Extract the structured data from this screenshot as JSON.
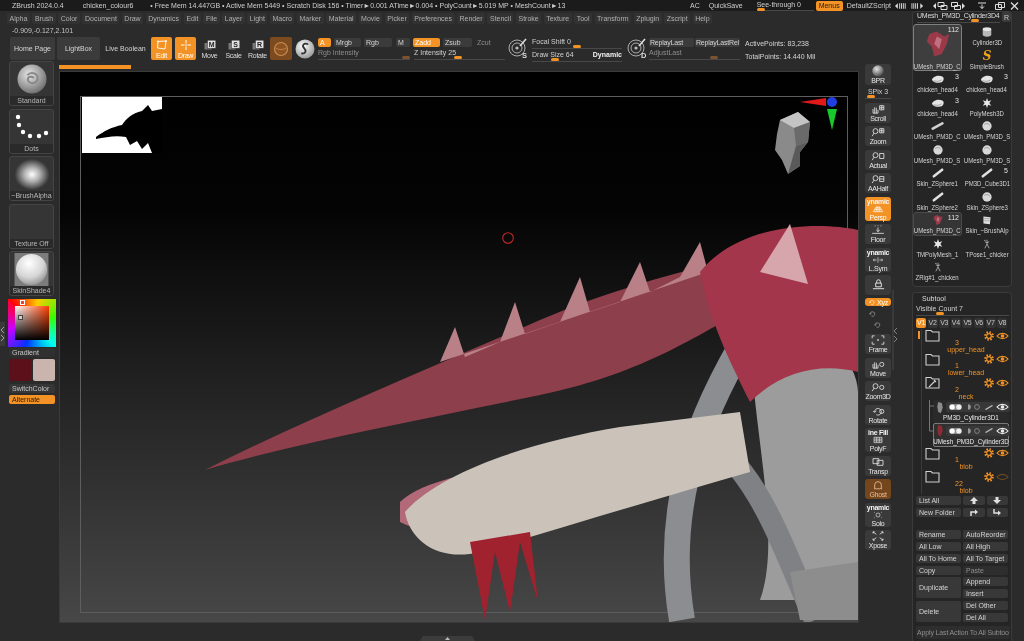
{
  "title_bar": {
    "app": "ZBrush 2024.0.4",
    "document": "chicken_colour6",
    "stats": "• Free Mem 14.447GB • Active Mem 5449 • Scratch Disk 156 • Timer►0.001 ATime►0.004 • PolyCount►5.019 MP • MeshCount►13",
    "ac": "AC",
    "quick_save": "QuickSave",
    "see_through": {
      "label": "See-through",
      "value": "0",
      "level": 0,
      "disabled": false
    },
    "menus": {
      "label": "Menus",
      "on": true
    },
    "script": "DefaultZScript"
  },
  "menu_bar": [
    "Alpha",
    "Brush",
    "Color",
    "Document",
    "Draw",
    "Dynamics",
    "Edit",
    "File",
    "Layer",
    "Light",
    "Macro",
    "Marker",
    "Material",
    "Movie",
    "Picker",
    "Preferences",
    "Render",
    "Stencil",
    "Stroke",
    "Texture",
    "Tool",
    "Transform",
    "Zplugin",
    "Zscript",
    "Help"
  ],
  "coordinates": "-0.909,-0.127,2.101",
  "top_shelf": {
    "nav_buttons": [
      {
        "label": "Home Page",
        "kind": "button",
        "on": false
      },
      {
        "label": "LightBox",
        "kind": "button",
        "on": false
      },
      {
        "label": "Live Boolean",
        "kind": "toggle",
        "on": false
      }
    ],
    "modes": [
      {
        "label": "Edit",
        "kind": "edit",
        "selected": true
      },
      {
        "label": "Draw",
        "kind": "draw",
        "selected": true
      },
      {
        "label": "Move",
        "kind": "transform",
        "key": "M",
        "selected": false
      },
      {
        "label": "Scale",
        "kind": "transform",
        "key": "S",
        "selected": false
      },
      {
        "label": "Rotate",
        "kind": "transform",
        "key": "R",
        "selected": false
      }
    ],
    "channels": [
      {
        "label": "A",
        "selected": true
      },
      {
        "label": "Mrgb",
        "selected": false
      },
      {
        "label": "Rgb",
        "selected": false
      },
      {
        "label": "M",
        "selected": false
      }
    ],
    "z_modes": [
      {
        "label": "Zadd",
        "selected": true,
        "disabled": false
      },
      {
        "label": "Zsub",
        "selected": false,
        "disabled": false
      },
      {
        "label": "Zcut",
        "selected": false,
        "disabled": true
      }
    ],
    "rgb_intensity": {
      "label": "Rgb Intensity",
      "level": 1,
      "disabled": true
    },
    "z_intensity": {
      "label": "Z Intensity",
      "value": "25",
      "level": 0.48,
      "disabled": false
    },
    "focal_key": "S",
    "focal_shift": {
      "label": "Focal Shift",
      "value": "0",
      "level": 0.5,
      "disabled": false
    },
    "draw_size": {
      "label": "Draw Size",
      "value": "64",
      "level": 0.23,
      "disabled": false,
      "dynamic": "Dynamic"
    },
    "replay_key": "D",
    "replay_buttons": [
      "ReplayLast",
      "ReplayLastRel"
    ],
    "adjust_last": {
      "label": "AdjustLast",
      "level": 0.73,
      "disabled": true
    },
    "points": [
      "ActivePoints: 83,238",
      "TotalPoints: 14.440 Mil"
    ]
  },
  "history_bar": {
    "level": 0.09
  },
  "left_panel": {
    "slots": [
      {
        "label": "Standard",
        "kind": "brush"
      },
      {
        "label": "Dots",
        "kind": "stroke"
      },
      {
        "label": "~BrushAlpha",
        "kind": "alpha"
      },
      {
        "label": "Texture Off",
        "kind": "texture"
      },
      {
        "label": "SkinShade4",
        "kind": "material"
      }
    ],
    "gradient": "Gradient",
    "swatches": [
      {
        "color": "#5c111a"
      },
      {
        "color": "#c9b4ae"
      }
    ],
    "switch_color": "SwitchColor",
    "alternate": {
      "label": "Alternate",
      "on": true
    }
  },
  "right_shelf": {
    "bpr": "BPR",
    "spix": {
      "label": "SPix",
      "value": "3",
      "level": 0.1,
      "disabled": false
    },
    "buttons": [
      {
        "label": "Scroll",
        "kind": "scroll",
        "on": false,
        "disabled": false
      },
      {
        "label": "Zoom",
        "kind": "zoom",
        "on": false,
        "disabled": false
      },
      {
        "label": "Actual",
        "kind": "actual",
        "on": false,
        "disabled": false
      },
      {
        "label": "AAHalf",
        "kind": "aahalf",
        "on": false,
        "disabled": false
      },
      {
        "top": "ynamic",
        "label": "Persp",
        "kind": "persp",
        "on": true,
        "disabled": false
      },
      {
        "label": "Floor",
        "kind": "floor",
        "on": false,
        "disabled": false
      },
      {
        "top": "ynamic",
        "label": "L.Sym",
        "kind": "lsym",
        "on": false,
        "disabled": false
      },
      {
        "kind": "lock",
        "on": false,
        "disabled": false
      },
      {
        "label": "Xyz",
        "kind": "xyz",
        "on": true,
        "disabled": false
      },
      {
        "kind": "rot_y",
        "on": false,
        "disabled": false
      },
      {
        "kind": "rot_z",
        "on": false,
        "disabled": false
      },
      {
        "label": "Frame",
        "kind": "frame",
        "on": false,
        "disabled": false
      },
      {
        "label": "Move",
        "kind": "move",
        "on": false,
        "disabled": false
      },
      {
        "label": "Zoom3D",
        "kind": "zoom3d",
        "on": false,
        "disabled": false
      },
      {
        "label": "Rotate",
        "kind": "rotate",
        "on": false,
        "disabled": false
      },
      {
        "top": "ine Fill",
        "label": "PolyF",
        "kind": "polyf",
        "on": false,
        "disabled": false
      },
      {
        "label": "Transp",
        "kind": "transp",
        "on": false,
        "disabled": false
      },
      {
        "label": "Ghost",
        "kind": "ghost",
        "on": true,
        "disabled": true
      },
      {
        "top": "ynamic",
        "label": "Solo",
        "kind": "solo",
        "on": false,
        "disabled": false
      },
      {
        "label": "Xpose",
        "kind": "xpose",
        "on": false,
        "disabled": false
      }
    ]
  },
  "tool_palette": {
    "current": "UMesh_PM3D_Cylinder3D4",
    "level": 0.72,
    "r_button": "R",
    "top_tools": [
      {
        "label": "UMesh_PM3D_C",
        "count": "112",
        "kind": "render",
        "selected": true
      },
      {
        "label": "Cylinder3D",
        "kind": "cylinder",
        "selected": false
      },
      {
        "label": "SimpleBrush",
        "kind": "simple",
        "glyph": "S",
        "selected": false
      }
    ],
    "tool_rows": [
      [
        {
          "label": "chicken_head4",
          "count": "3",
          "kind": "head",
          "selected": false
        },
        {
          "label": "chicken_head4",
          "count": "3",
          "kind": "head",
          "selected": false
        }
      ],
      [
        {
          "label": "chicken_head4",
          "count": "3",
          "kind": "head",
          "selected": false
        },
        {
          "label": "PolyMesh3D",
          "kind": "star",
          "selected": false
        }
      ],
      [
        {
          "label": "UMesh_PM3D_C",
          "kind": "tube",
          "selected": false
        },
        {
          "label": "UMesh_PM3D_S",
          "kind": "sphere",
          "selected": false
        }
      ],
      [
        {
          "label": "UMesh_PM3D_S",
          "kind": "sphere",
          "selected": false
        },
        {
          "label": "UMesh_PM3D_S",
          "kind": "sphere",
          "selected": false
        }
      ],
      [
        {
          "label": "Skin_ZSphere1",
          "kind": "stick",
          "selected": false
        },
        {
          "label": "PM3D_Cube3D1",
          "count": "5",
          "kind": "stick",
          "selected": false
        }
      ],
      [
        {
          "label": "Skin_ZSphere2",
          "kind": "stick",
          "selected": false
        },
        {
          "label": "Skin_ZSphere3",
          "kind": "sphere",
          "selected": false
        }
      ],
      [
        {
          "label": "UMesh_PM3D_C",
          "count": "112",
          "kind": "render",
          "selected": false
        },
        {
          "label": "Skin_~BrushAlp",
          "kind": "alpha",
          "selected": false
        }
      ],
      [
        {
          "label": "TMPolyMesh_1",
          "kind": "star",
          "selected": false
        },
        {
          "label": "TPose1_chicker",
          "kind": "rig",
          "selected": false
        }
      ],
      [
        {
          "label": "ZRig#1_chicken",
          "kind": "rig",
          "selected": false
        }
      ]
    ]
  },
  "subtool": {
    "title": "Subtool",
    "visible_count": {
      "label": "Visible Count",
      "value": "7",
      "level": 0.24,
      "disabled": false
    },
    "versions": [
      {
        "label": "V1",
        "selected": true
      },
      {
        "label": "V2",
        "selected": false
      },
      {
        "label": "V3",
        "selected": false
      },
      {
        "label": "V4",
        "selected": false
      },
      {
        "label": "V5",
        "selected": false
      },
      {
        "label": "V6",
        "selected": false
      },
      {
        "label": "V7",
        "selected": false
      },
      {
        "label": "V8",
        "selected": false
      }
    ],
    "items": [
      {
        "kind": "folder",
        "name": "upper_head",
        "count": "3",
        "expanded": false,
        "visible": true
      },
      {
        "kind": "folder",
        "name": "lower_head",
        "count": "1",
        "expanded": false,
        "visible": true
      },
      {
        "kind": "folder",
        "name": "neck",
        "count": "2",
        "expanded": true,
        "visible": true,
        "children": [
          {
            "kind": "mesh",
            "name": "PM3D_Cylinder3D1",
            "color": "#8c8c8c",
            "visible": true,
            "selected": false
          },
          {
            "kind": "mesh",
            "name": "UMesh_PM3D_Cylinder3D",
            "color": "#8e2a34",
            "visible": true,
            "selected": true
          }
        ]
      },
      {
        "kind": "folder",
        "name": "blob",
        "count": "1",
        "expanded": false,
        "visible": true
      },
      {
        "kind": "folder",
        "name": "blob",
        "count": "22",
        "expanded": false,
        "visible": false
      }
    ],
    "list_all": "List All",
    "new_folder": "New Folder",
    "actions": [
      {
        "label": "Rename",
        "disabled": false
      },
      {
        "label": "AutoReorder",
        "disabled": false
      },
      {
        "label": "All Low",
        "disabled": false
      },
      {
        "label": "All High",
        "disabled": false
      },
      {
        "label": "All To Home",
        "disabled": false
      },
      {
        "label": "All To Target",
        "disabled": false
      },
      {
        "label": "Copy",
        "disabled": false
      },
      {
        "label": "Paste",
        "disabled": true
      }
    ],
    "duplicate": {
      "label": "Duplicate",
      "disabled": false
    },
    "add_actions": [
      {
        "label": "Append",
        "disabled": false
      },
      {
        "label": "Insert",
        "disabled": false
      }
    ],
    "delete": {
      "label": "Delete",
      "disabled": false
    },
    "delete_actions": [
      {
        "label": "Del Other",
        "disabled": false
      },
      {
        "label": "Del All",
        "disabled": false
      }
    ],
    "apply_all": {
      "label": "Apply Last Action To All Subtoo",
      "disabled": true
    }
  }
}
